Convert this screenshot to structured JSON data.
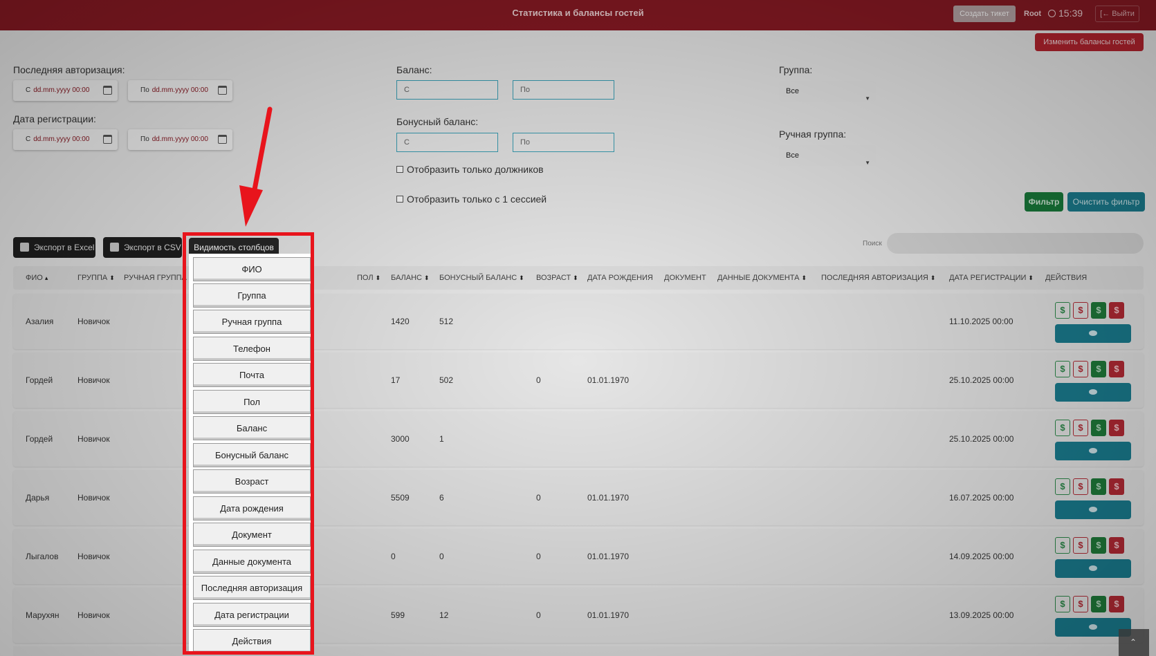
{
  "header": {
    "title": "Статистика и балансы гостей",
    "create_ticket": "Создать тикет",
    "user": "Root",
    "time": "15:39",
    "logout": "Выйти"
  },
  "change_balances_button": "Изменить балансы гостей",
  "filters": {
    "last_auth_label": "Последняя авторизация:",
    "reg_date_label": "Дата регистрации:",
    "from_prefix": "С",
    "to_prefix": "По",
    "date_placeholder": "dd.mm.yyyy 00:00",
    "balance_label": "Баланс:",
    "bonus_balance_label": "Бонусный баланс:",
    "input_from": "С",
    "input_to": "По",
    "debtors_only": "Отобразить только должников",
    "one_session_only": "Отобразить только с 1 сессией",
    "group_label": "Группа:",
    "group_value": "Все",
    "manual_group_label": "Ручная группа:",
    "manual_group_value": "Все",
    "filter_button": "Фильтр",
    "clear_button": "Очистить фильтр"
  },
  "toolbar": {
    "export_excel": "Экспорт в Excel",
    "export_csv": "Экспорт в CSV",
    "column_visibility": "Видимость столбцов",
    "search_label": "Поиск"
  },
  "table": {
    "headers": {
      "fio": "ФИО",
      "group": "ГРУППА",
      "manual_group": "РУЧНАЯ ГРУППА",
      "gender": "ПОЛ",
      "balance": "БАЛАНС",
      "bonus_balance": "БОНУСНЫЙ БАЛАНС",
      "age": "ВОЗРАСТ",
      "birth_date": "ДАТА РОЖДЕНИЯ",
      "document": "ДОКУМЕНТ",
      "document_data": "ДАННЫЕ ДОКУМЕНТА",
      "last_auth": "ПОСЛЕДНЯЯ АВТОРИЗАЦИЯ",
      "reg_date": "ДАТА РЕГИСТРАЦИИ",
      "actions": "ДЕЙСТВИЯ"
    },
    "rows": [
      {
        "fio": "Азалия",
        "group": "Новичок",
        "balance": "1420",
        "bonus": "512",
        "age": "",
        "birth": "",
        "reg": "11.10.2025 00:00"
      },
      {
        "fio": "Гордей",
        "group": "Новичок",
        "balance": "17",
        "bonus": "502",
        "age": "0",
        "birth": "01.01.1970",
        "reg": "25.10.2025 00:00"
      },
      {
        "fio": "Гордей",
        "group": "Новичок",
        "balance": "3000",
        "bonus": "1",
        "age": "",
        "birth": "",
        "reg": "25.10.2025 00:00"
      },
      {
        "fio": "Дарья",
        "group": "Новичок",
        "balance": "5509",
        "bonus": "6",
        "age": "0",
        "birth": "01.01.1970",
        "reg": "16.07.2025 00:00"
      },
      {
        "fio": "Лыгалов",
        "group": "Новичок",
        "balance": "0",
        "bonus": "0",
        "age": "0",
        "birth": "01.01.1970",
        "reg": "14.09.2025 00:00"
      },
      {
        "fio": "Марухян",
        "group": "Новичок",
        "balance": "599",
        "bonus": "12",
        "age": "0",
        "birth": "01.01.1970",
        "reg": "13.09.2025 00:00"
      }
    ],
    "action_symbol": "$"
  },
  "column_menu": [
    "ФИО",
    "Группа",
    "Ручная группа",
    "Телефон",
    "Почта",
    "Пол",
    "Баланс",
    "Бонусный баланс",
    "Возраст",
    "Дата рождения",
    "Документ",
    "Данные документа",
    "Последняя авторизация",
    "Дата регистрации",
    "Действия"
  ],
  "colors": {
    "header_bg": "#8b1a24",
    "highlight_red": "#e8141c",
    "teal": "#1a7d90",
    "green": "#1f7b3a"
  }
}
